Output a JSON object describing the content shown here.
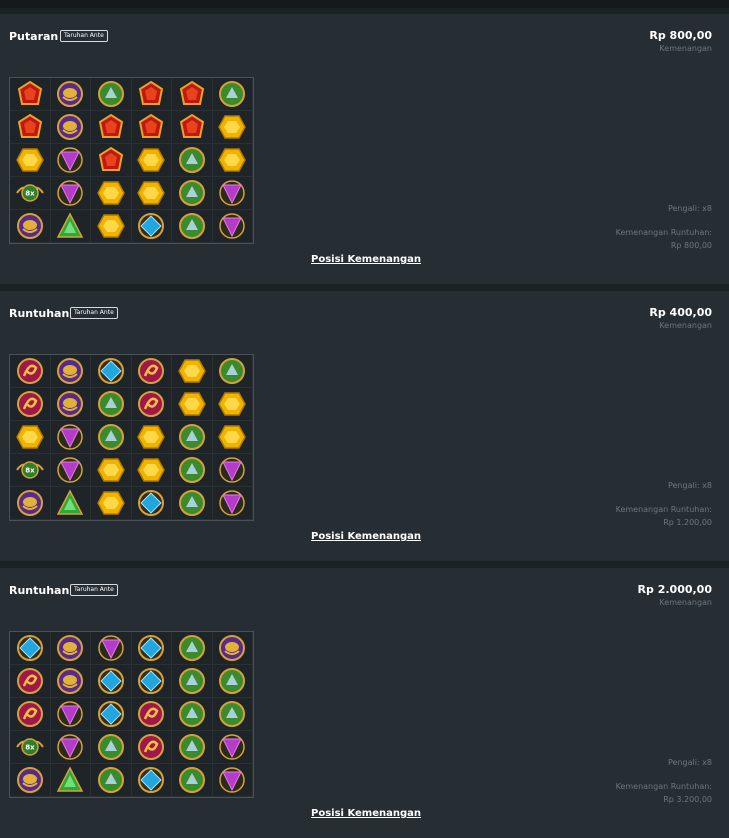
{
  "rounds": [
    {
      "title": "Putaran",
      "badge": "Taruhan Ante",
      "amount": "Rp 800,00",
      "amount_label": "Kemenangan",
      "multiplier_text": "Pengali: x8",
      "cascade_label": "Kemenangan Runtuhan:",
      "cascade_value": "Rp 800,00",
      "link_label": "Posisi Kemenangan",
      "grid": [
        [
          "red",
          "scarab",
          "green",
          "red",
          "red",
          "green"
        ],
        [
          "red",
          "scarab",
          "red",
          "red",
          "red",
          "yellow"
        ],
        [
          "yellow",
          "purple",
          "red",
          "yellow",
          "green",
          "yellow"
        ],
        [
          "mult",
          "purple",
          "yellow",
          "yellow",
          "green",
          "purple"
        ],
        [
          "scarab",
          "greentri",
          "yellow",
          "blue",
          "green",
          "purple"
        ]
      ]
    },
    {
      "title": "Runtuhan",
      "badge": "Taruhan Ante",
      "amount": "Rp 400,00",
      "amount_label": "Kemenangan",
      "multiplier_text": "Pengali: x8",
      "cascade_label": "Kemenangan Runtuhan:",
      "cascade_value": "Rp 1.200,00",
      "link_label": "Posisi Kemenangan",
      "grid": [
        [
          "snake",
          "scarab",
          "blue",
          "snake",
          "yellow",
          "green"
        ],
        [
          "snake",
          "scarab",
          "green",
          "snake",
          "yellow",
          "yellow"
        ],
        [
          "yellow",
          "purple",
          "green",
          "yellow",
          "green",
          "yellow"
        ],
        [
          "mult",
          "purple",
          "yellow",
          "yellow",
          "green",
          "purple"
        ],
        [
          "scarab",
          "greentri",
          "yellow",
          "blue",
          "green",
          "purple"
        ]
      ]
    },
    {
      "title": "Runtuhan",
      "badge": "Taruhan Ante",
      "amount": "Rp 2.000,00",
      "amount_label": "Kemenangan",
      "multiplier_text": "Pengali: x8",
      "cascade_label": "Kemenangan Runtuhan:",
      "cascade_value": "Rp 3.200,00",
      "link_label": "Posisi Kemenangan",
      "grid": [
        [
          "blue",
          "scarab",
          "purple",
          "blue",
          "green",
          "scarab"
        ],
        [
          "snake",
          "scarab",
          "blue",
          "blue",
          "green",
          "green"
        ],
        [
          "snake",
          "purple",
          "blue",
          "snake",
          "green",
          "green"
        ],
        [
          "mult",
          "purple",
          "green",
          "snake",
          "green",
          "purple"
        ],
        [
          "scarab",
          "greentri",
          "green",
          "blue",
          "green",
          "purple"
        ]
      ]
    }
  ],
  "multiplier_symbol": "8x",
  "symbol_icons": {
    "red": "red-gem-icon",
    "yellow": "yellow-hexagon-gem-icon",
    "green": "green-orb-icon",
    "blue": "blue-diamond-gem-icon",
    "purple": "purple-triangle-gem-icon",
    "greentri": "green-triangle-gem-icon",
    "scarab": "scarab-icon",
    "snake": "snake-amulet-icon",
    "mult": "multiplier-orb-icon"
  }
}
